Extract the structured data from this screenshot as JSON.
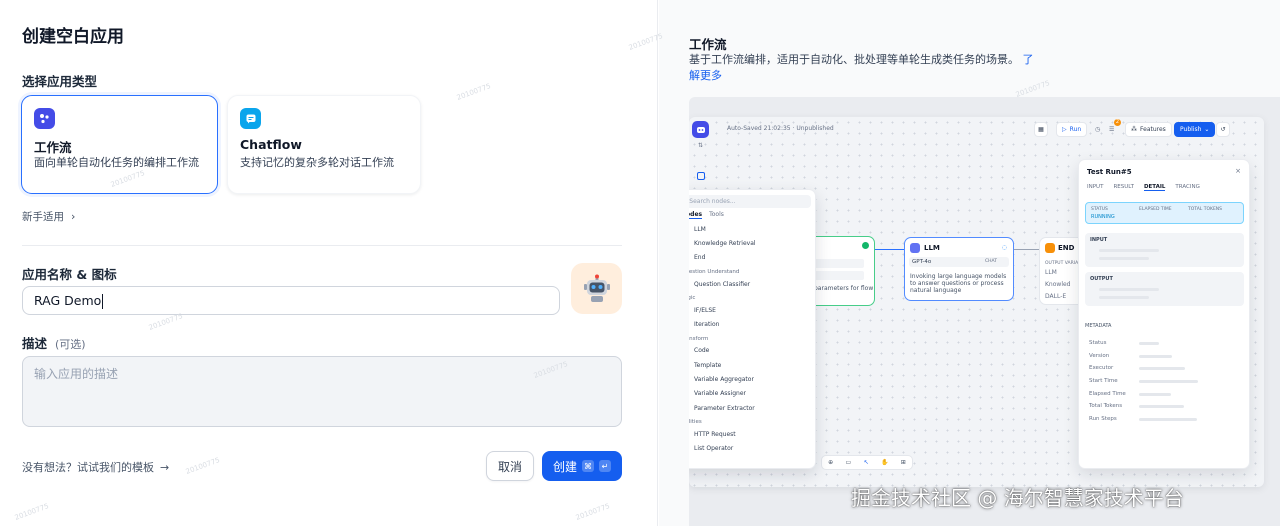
{
  "dialog": {
    "title": "创建空白应用",
    "app_type_label": "选择应用类型",
    "types": [
      {
        "title": "工作流",
        "desc": "面向单轮自动化任务的编排工作流",
        "selected": true,
        "icon": "workflow-icon",
        "color": "#444ce7"
      },
      {
        "title": "Chatflow",
        "desc": "支持记忆的复杂多轮对话工作流",
        "selected": false,
        "icon": "chat-bubble-icon",
        "color": "#0ba5ec"
      }
    ],
    "beginner_label": "新手适用",
    "name_icon_label": "应用名称 & 图标",
    "name_value": "RAG Demo",
    "desc_label": "描述",
    "desc_optional": "(可选)",
    "desc_placeholder": "输入应用的描述",
    "template_hint": "没有想法？试试我们的模板",
    "cancel_label": "取消",
    "create_label": "创建",
    "accent": "#155eef"
  },
  "panel": {
    "title": "工作流",
    "desc": "基于工作流编排，适用于自动化、批处理等单轮生成类任务的场景。",
    "learn_more": "了解更多"
  },
  "preview": {
    "autosaved": "Auto-Saved 21:02:35 · Unpublished",
    "run_label": "Run",
    "features_label": "Features",
    "publish_label": "Publish",
    "badge_count": "2",
    "node_search_placeholder": "Search nodes...",
    "node_tabs": [
      "Nodes",
      "Tools"
    ],
    "groups": [
      {
        "header": "",
        "items": [
          {
            "name": "LLM",
            "color": "#6172f3"
          },
          {
            "name": "Knowledge Retrieval",
            "color": "#16b364"
          },
          {
            "name": "End",
            "color": "#f79009"
          }
        ]
      },
      {
        "header": "Question Understand",
        "items": [
          {
            "name": "Question Classifier",
            "color": "#16b364"
          }
        ]
      },
      {
        "header": "Logic",
        "items": [
          {
            "name": "IF/ELSE",
            "color": "#06aed4"
          },
          {
            "name": "Iteration",
            "color": "#06aed4"
          }
        ]
      },
      {
        "header": "Transform",
        "items": [
          {
            "name": "Code",
            "color": "#2e90fa"
          },
          {
            "name": "Template",
            "color": "#2e90fa"
          },
          {
            "name": "Variable Aggregator",
            "color": "#2e90fa"
          },
          {
            "name": "Variable Assigner",
            "color": "#2e90fa"
          },
          {
            "name": "Parameter Extractor",
            "color": "#2e90fa"
          }
        ]
      },
      {
        "header": "Utilities",
        "items": [
          {
            "name": "HTTP Request",
            "color": "#875bf7"
          },
          {
            "name": "List Operator",
            "color": "#875bf7"
          }
        ]
      }
    ],
    "llm_node": {
      "title": "LLM",
      "model": "GPT-4o",
      "mode": "CHAT",
      "desc": "Invoking large language models to answer questions or process natural language"
    },
    "start_node_desc": "parameters for flow",
    "end_node": {
      "title": "END",
      "output_label": "OUTPUT VARIA",
      "outputs": [
        "LLM",
        "Knowled",
        "DALL-E"
      ]
    },
    "test_run": {
      "title": "Test Run#5",
      "tabs": [
        "INPUT",
        "RESULT",
        "DETAIL",
        "TRACING"
      ],
      "active_tab": "DETAIL",
      "status_label": "STATUS",
      "status_value": "RUNNING",
      "elapsed_label": "ELAPSED TIME",
      "tokens_label": "TOTAL TOKENS",
      "input_label": "INPUT",
      "output_label": "OUTPUT",
      "metadata_label": "METADATA",
      "metadata_rows": [
        "Status",
        "Version",
        "Executor",
        "Start Time",
        "Elapsed Time",
        "Total Tokens",
        "Run Steps"
      ]
    }
  },
  "watermark": "20100775",
  "credit": "掘金技术社区 @ 海尔智慧家技术平台"
}
